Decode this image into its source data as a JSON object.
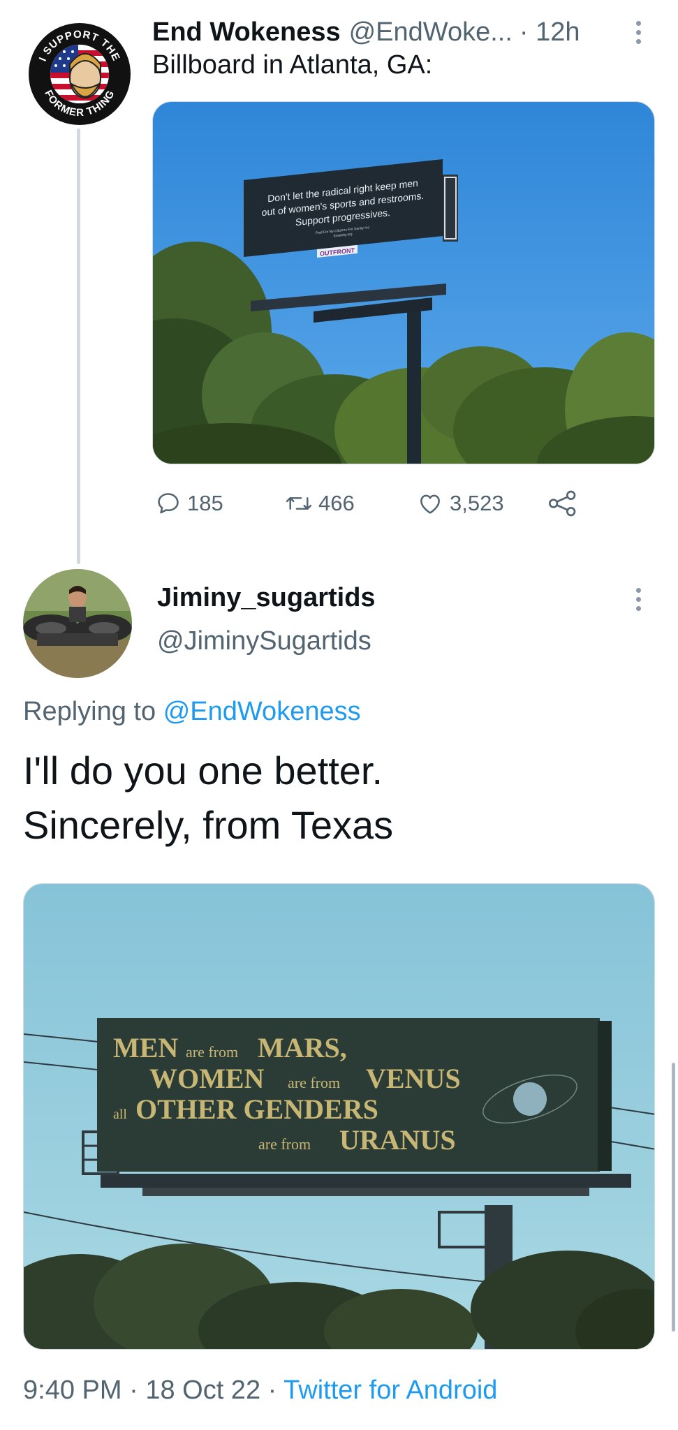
{
  "tweet": {
    "author_name": "End Wokeness",
    "author_handle": "@EndWoke...",
    "time": "· 12h",
    "text": "Billboard in Atlanta, GA:",
    "avatar_ring_text_top": "I SUPPORT THE",
    "avatar_ring_text_bottom": "FORMER THING",
    "billboard": {
      "line1": "Don't let the radical right keep men",
      "line2": "out of women's sports and restrooms.",
      "line3": "Support progressives.",
      "paid_for": "Paid For By Citizens For Sanity Inc.",
      "site": "forsanity.org",
      "brand": "OUTFRONT"
    },
    "stats": {
      "replies": "185",
      "retweets": "466",
      "likes": "3,523"
    }
  },
  "reply": {
    "author_name": "Jiminy_sugartids",
    "author_handle": "@JiminySugartids",
    "replying_prefix": "Replying to",
    "replying_to": "@EndWokeness",
    "text_line1": "I'll do you one better.",
    "text_line2": "Sincerely, from Texas",
    "billboard": {
      "w1": "MEN",
      "w2": "are from",
      "w3": "MARS,",
      "w4": "WOMEN",
      "w5": "are from",
      "w6": "VENUS",
      "w7": "all",
      "w8": "OTHER GENDERS",
      "w9": "are from",
      "w10": "URANUS"
    },
    "footer": {
      "time": "9:40 PM",
      "date": "18 Oct 22",
      "source": "Twitter for Android"
    }
  },
  "colors": {
    "link_blue": "#1d9bf0",
    "secondary_text": "#536471",
    "billboard_gold": "#c8b774"
  }
}
